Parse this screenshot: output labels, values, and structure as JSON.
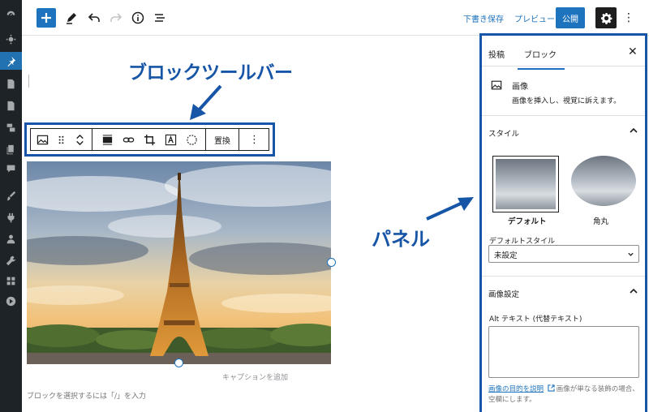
{
  "adminbar": {
    "icons": [
      "dashboard-icon",
      "appearance-icon",
      "pin-icon",
      "page-icon",
      "page-icon",
      "media-icon",
      "pages-icon",
      "comments-icon",
      "brush-icon",
      "plugins-icon",
      "users-icon",
      "tools-icon",
      "settings-icon",
      "play-icon"
    ],
    "active_index": 2
  },
  "topbar": {
    "draft_label": "下書き保存",
    "preview_label": "プレビュー",
    "publish_label": "公開",
    "more_label": "⋮"
  },
  "annotations": {
    "toolbar_label": "ブロックツールバー",
    "panel_label": "パネル",
    "accent": "#1755a6"
  },
  "block_toolbar": {
    "replace_label": "置換",
    "more_label": "⋮"
  },
  "editor": {
    "caption_placeholder": "キャプションを追加",
    "hint": "ブロックを選択するには「/」を入力"
  },
  "panel": {
    "tab_post": "投稿",
    "tab_block": "ブロック",
    "close_label": "✕",
    "block_name": "画像",
    "block_desc": "画像を挿入し、視覚に訴えます。",
    "style_section": "スタイル",
    "style_default": "デフォルト",
    "style_rounded": "角丸",
    "default_style_label": "デフォルトスタイル",
    "default_style_value": "未設定",
    "image_settings": "画像設定",
    "alt_label": "Alt テキスト (代替テキスト)",
    "alt_help_link": "画像の目的を説明",
    "alt_help_text": "画像が単なる装飾の場合、空欄にします。"
  },
  "colors": {
    "wp_blue": "#1e73be",
    "admin_dark": "#1d2327"
  }
}
